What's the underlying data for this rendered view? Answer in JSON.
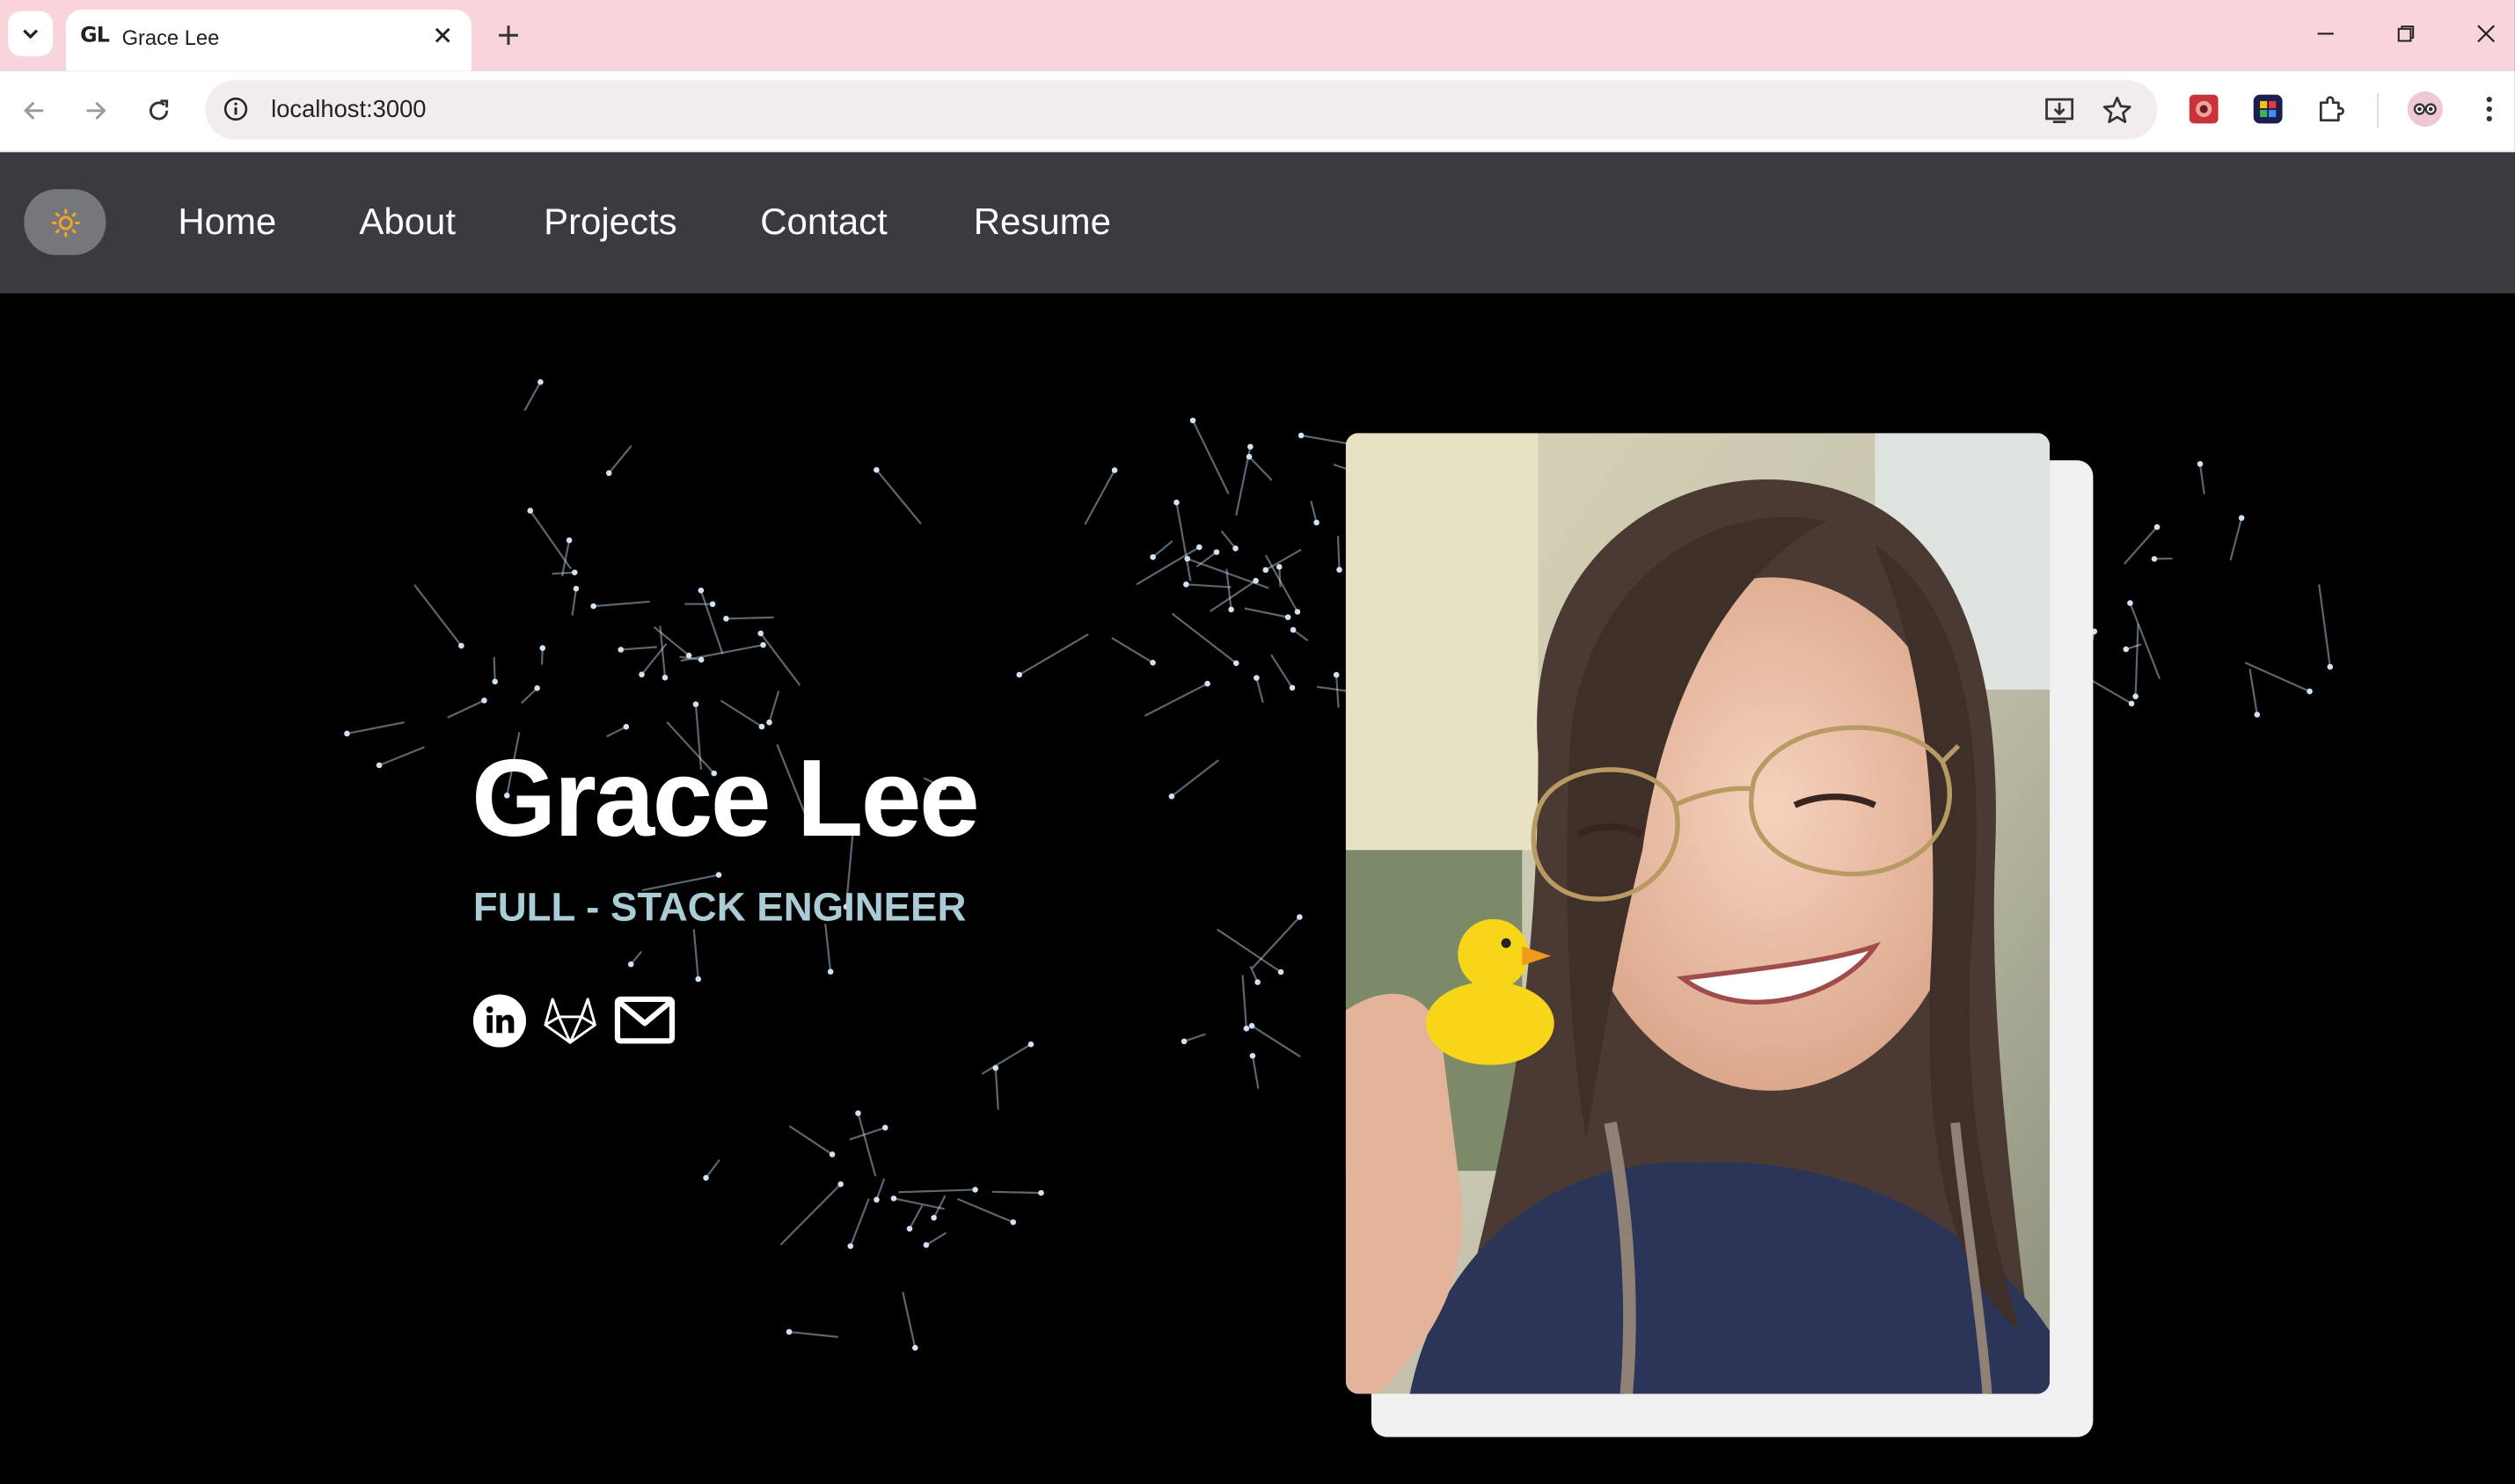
{
  "browser": {
    "tab_favicon": "GL",
    "tab_title": "Grace Lee",
    "url": "localhost:3000",
    "icons": [
      "tab-list-icon",
      "close-icon",
      "plus-icon",
      "minimize-icon",
      "restore-icon",
      "window-close-icon",
      "back-arrow-icon",
      "forward-arrow-icon",
      "reload-icon",
      "site-info-icon",
      "install-app-icon",
      "bookmark-star-icon",
      "extensions-puzzle-icon",
      "kebab-menu-icon",
      "profile-avatar-icon"
    ]
  },
  "nav": {
    "theme_icon": "sun-icon",
    "links": [
      {
        "label": "Home"
      },
      {
        "label": "About"
      },
      {
        "label": "Projects"
      },
      {
        "label": "Contact"
      },
      {
        "label": "Resume"
      }
    ]
  },
  "hero": {
    "name": "Grace Lee",
    "role": "FULL - STACK ENGINEER",
    "social": [
      "linkedin-icon",
      "gitlab-icon",
      "email-icon"
    ],
    "photo": "portrait-photo"
  },
  "colors": {
    "tabbar_bg": "#f9d4dc",
    "nav_bg": "#3a3b40",
    "hero_bg": "#000000",
    "role_color": "#a9ccd7",
    "star_color": "#cfe3f5"
  }
}
